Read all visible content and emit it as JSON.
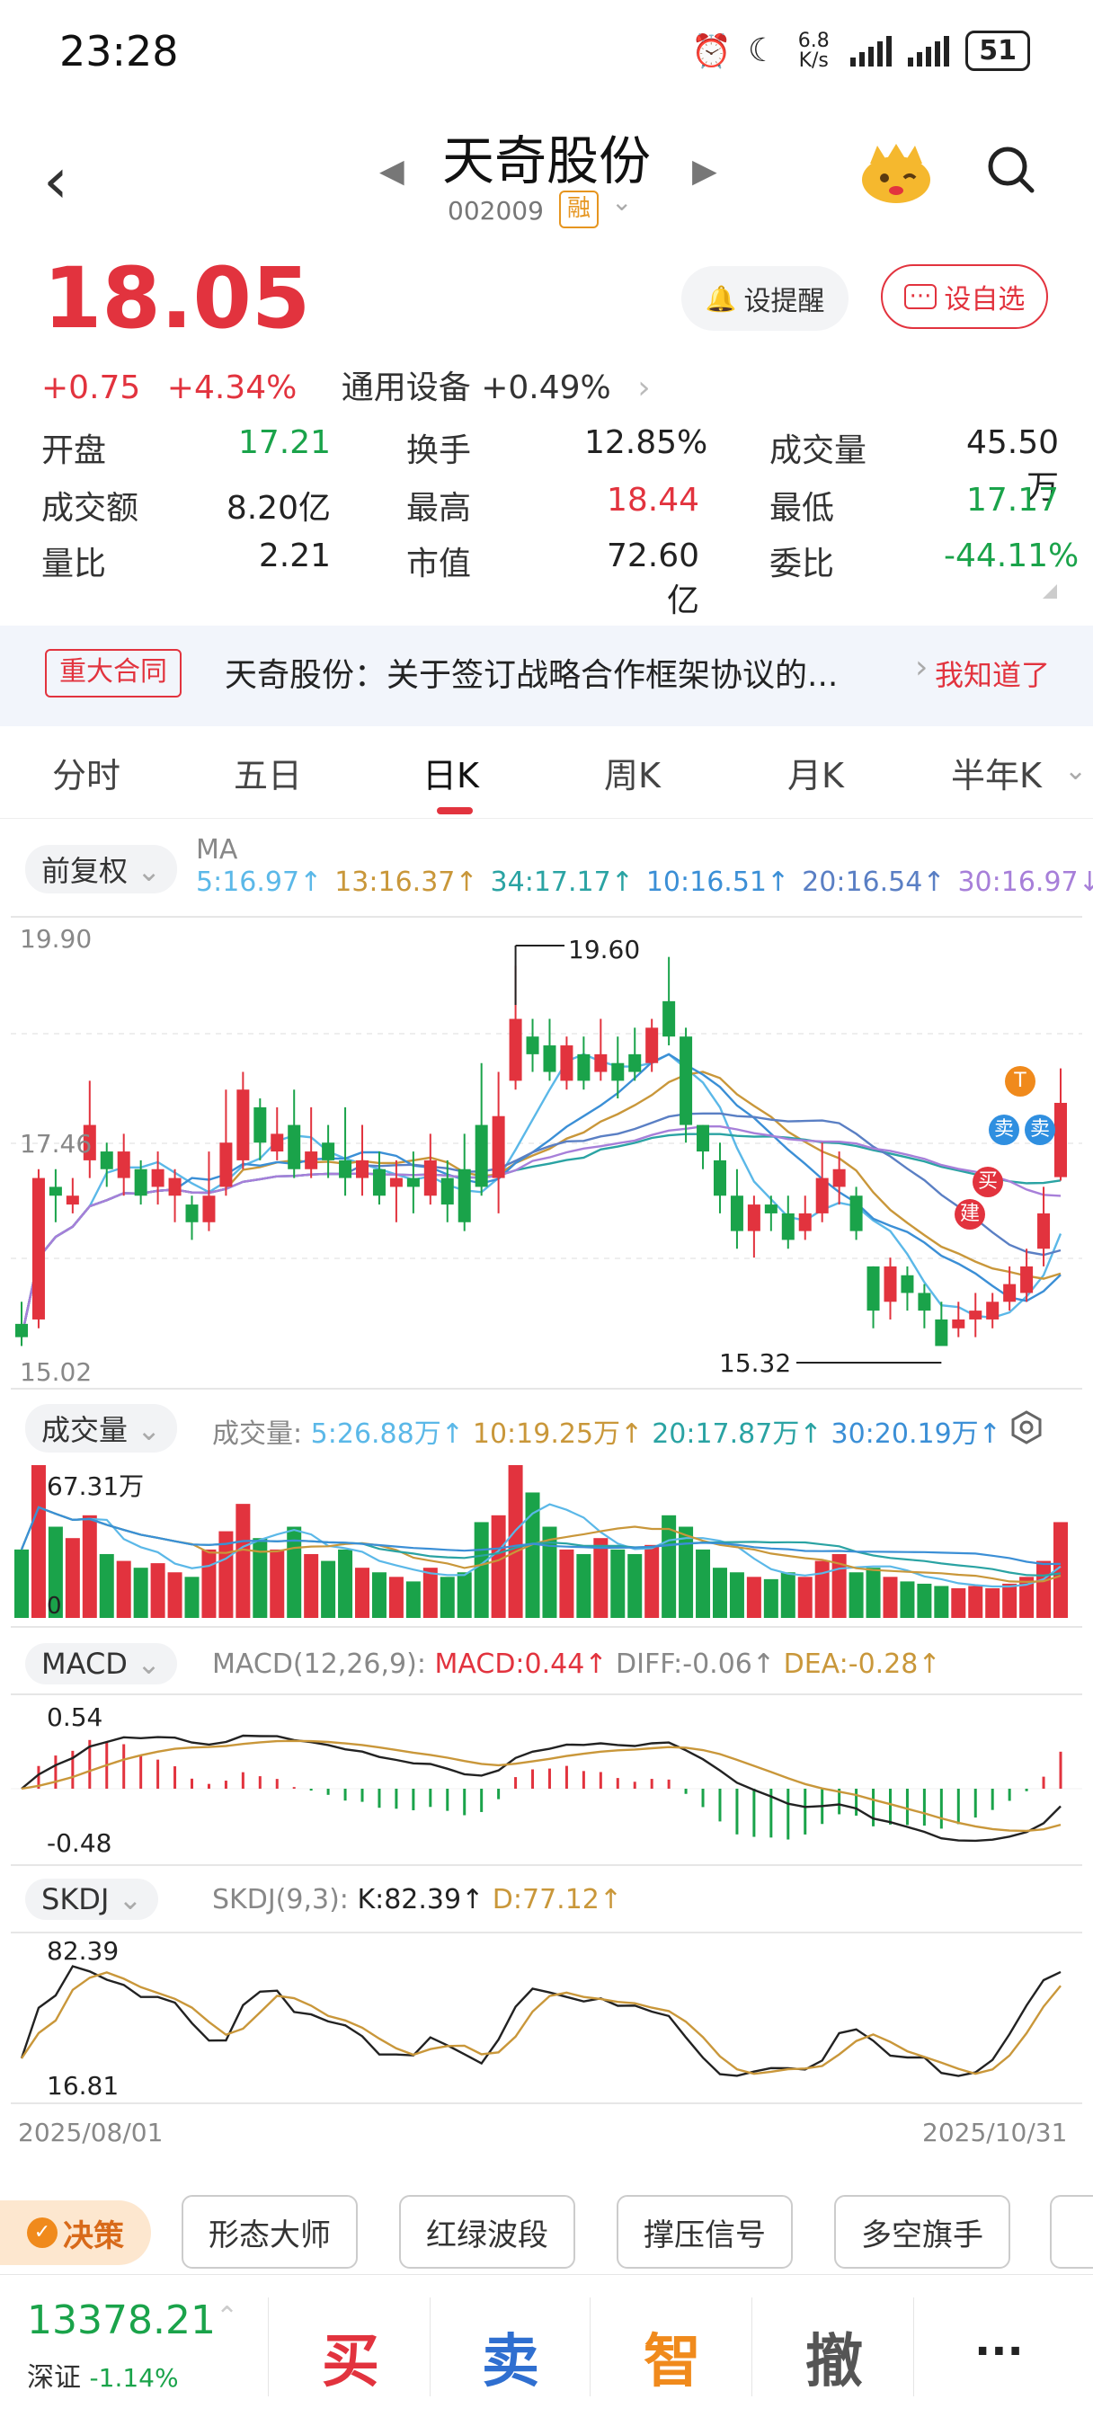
{
  "status_bar": {
    "time": "23:28",
    "net_speed": "6.8\nK/s",
    "battery": "51"
  },
  "header": {
    "stock_name": "天奇股份",
    "stock_code": "002009",
    "badge": "融"
  },
  "quote": {
    "price": "18.05",
    "change": "+0.75",
    "change_pct": "+4.34%",
    "sector": "通用设备 +0.49%",
    "remind_label": "设提醒",
    "fav_label": "设自选",
    "stats": [
      {
        "label": "开盘",
        "value": "17.21",
        "color": "green"
      },
      {
        "label": "换手",
        "value": "12.85%",
        "color": "black"
      },
      {
        "label": "成交量",
        "value": "45.50万",
        "color": "black"
      },
      {
        "label": "成交额",
        "value": "8.20亿",
        "color": "black"
      },
      {
        "label": "最高",
        "value": "18.44",
        "color": "red"
      },
      {
        "label": "最低",
        "value": "17.17",
        "color": "green"
      },
      {
        "label": "量比",
        "value": "2.21",
        "color": "black"
      },
      {
        "label": "市值",
        "value": "72.60亿",
        "color": "black"
      },
      {
        "label": "委比",
        "value": "-44.11%",
        "color": "green"
      }
    ]
  },
  "notice": {
    "tag": "重大合同",
    "text": "天奇股份：关于签订战略合作框架协议的...",
    "ack": "我知道了"
  },
  "tabs": [
    "分时",
    "五日",
    "日K",
    "周K",
    "月K",
    "半年K"
  ],
  "kline": {
    "adjust": "前复权",
    "ma_label": "MA",
    "ma": [
      {
        "text": "5:16.97",
        "color": "#5bb8e8"
      },
      {
        "text": "13:16.37",
        "color": "#c9973a"
      },
      {
        "text": "34:17.17",
        "color": "#2aa3a3"
      },
      {
        "text": "10:16.51",
        "color": "#3b8fd6"
      },
      {
        "text": "20:16.54",
        "color": "#5a7fc4"
      },
      {
        "text": "30:16.97",
        "color": "#a77fd9"
      }
    ],
    "y_high": "19.90",
    "y_mid": "17.46",
    "y_low": "15.02",
    "max_label": "19.60",
    "min_label": "15.32",
    "markers": {
      "t": "T",
      "sell": "卖",
      "buy": "买",
      "build": "建"
    }
  },
  "volume": {
    "title": "成交量",
    "label": "成交量:",
    "items": [
      {
        "text": "5:26.88万",
        "color": "#5bb8e8"
      },
      {
        "text": "10:19.25万",
        "color": "#c9973a"
      },
      {
        "text": "20:17.87万",
        "color": "#2aa3a3"
      },
      {
        "text": "30:20.19万",
        "color": "#3b8fd6"
      }
    ],
    "max": "67.31万",
    "zero": "0"
  },
  "macd": {
    "title": "MACD",
    "params": "MACD(12,26,9):",
    "macd": "MACD:0.44",
    "diff": "DIFF:-0.06",
    "dea": "DEA:-0.28",
    "y_high": "0.54",
    "y_low": "-0.48"
  },
  "skdj": {
    "title": "SKDJ",
    "params": "SKDJ(9,3):",
    "k": "K:82.39",
    "d": "D:77.12",
    "y_high": "82.39",
    "y_low": "16.81"
  },
  "dates": {
    "start": "2025/08/01",
    "end": "2025/10/31"
  },
  "strategy": {
    "decision": "决策",
    "buttons": [
      "形态大师",
      "红绿波段",
      "撑压信号",
      "多空旗手"
    ]
  },
  "bottom": {
    "index_value": "13378.21",
    "index_name": "深证",
    "index_change": "-1.14%",
    "actions": [
      "买",
      "卖",
      "智",
      "撤"
    ],
    "more": "···"
  }
}
